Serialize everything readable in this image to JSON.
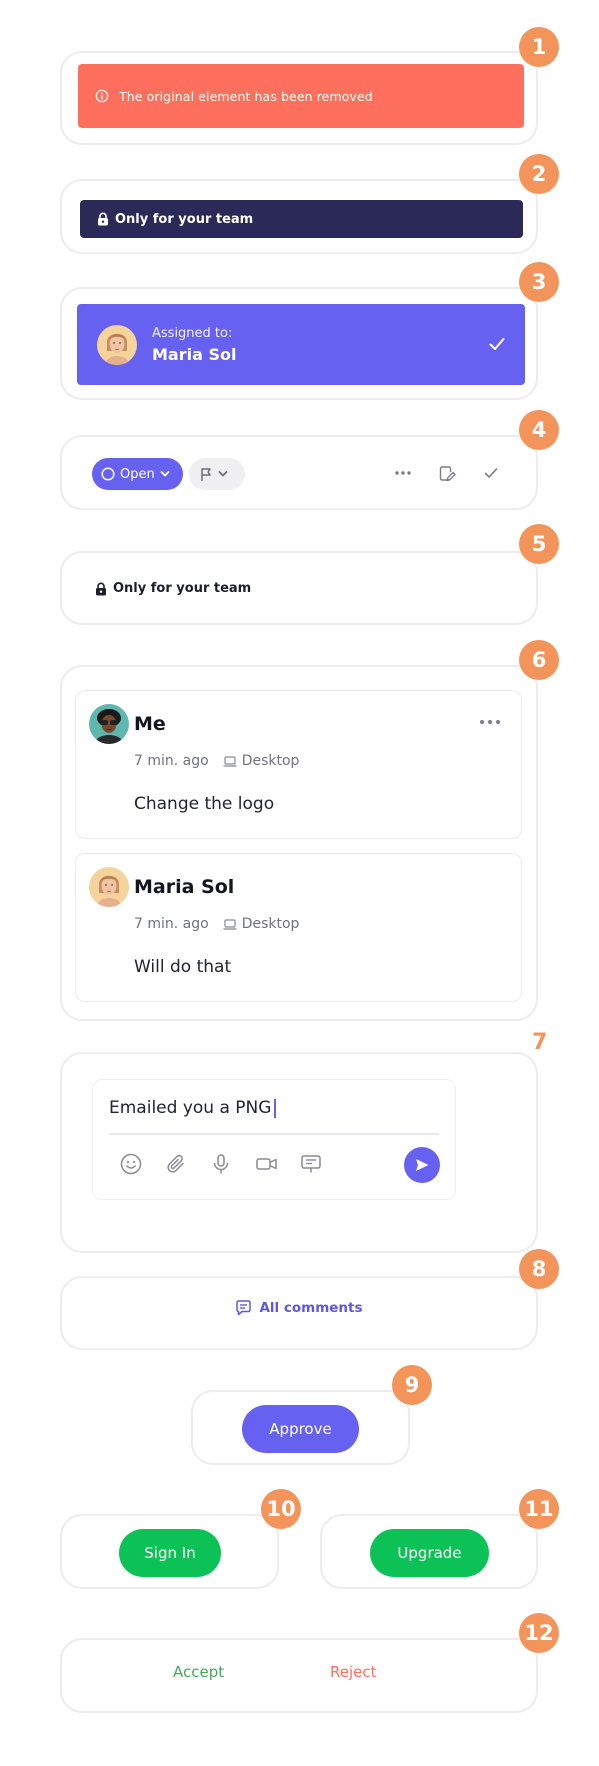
{
  "badges": [
    "1",
    "2",
    "3",
    "4",
    "5",
    "6",
    "7",
    "8",
    "9",
    "10",
    "11",
    "12"
  ],
  "removed_alert": {
    "text": "The original element has been removed",
    "icon": "info-icon",
    "color": "#ff6f5e"
  },
  "team_banner": {
    "text": "Only for your team",
    "icon": "lock-icon",
    "color": "#2b2957"
  },
  "assigned_card": {
    "label": "Assigned to:",
    "name": "Maria Sol",
    "icon": "check-icon",
    "color": "#6761f1"
  },
  "status_toolbar": {
    "status_label": "Open",
    "icons": [
      "circle-icon",
      "chevron-down-icon",
      "flag-icon",
      "chevron-down-icon",
      "more-horizontal-icon",
      "edit-document-icon",
      "check-icon"
    ]
  },
  "team_plain": {
    "text": "Only for your team",
    "icon": "lock-icon"
  },
  "comments": [
    {
      "author": "Me",
      "time": "7 min. ago",
      "device": "Desktop",
      "body": "Change the logo"
    },
    {
      "author": "Maria Sol",
      "time": "7 min. ago",
      "device": "Desktop",
      "body": "Will do that"
    }
  ],
  "composer": {
    "value": "Emailed you a PNG",
    "tools": [
      "emoji-icon",
      "paperclip-icon",
      "microphone-icon",
      "video-icon",
      "screen-share-icon"
    ],
    "send_icon": "send-icon"
  },
  "all_comments": {
    "label": "All comments",
    "icon": "comment-icon"
  },
  "approve": {
    "label": "Approve"
  },
  "sign_in": {
    "label": "Sign In"
  },
  "upgrade": {
    "label": "Upgrade"
  },
  "accept_reject": {
    "accept": "Accept",
    "reject": "Reject"
  },
  "colors": {
    "accent": "#6761f1",
    "badge": "#f3945a",
    "green": "#0cc156",
    "accept": "#44a958",
    "reject": "#ff6f5e"
  }
}
